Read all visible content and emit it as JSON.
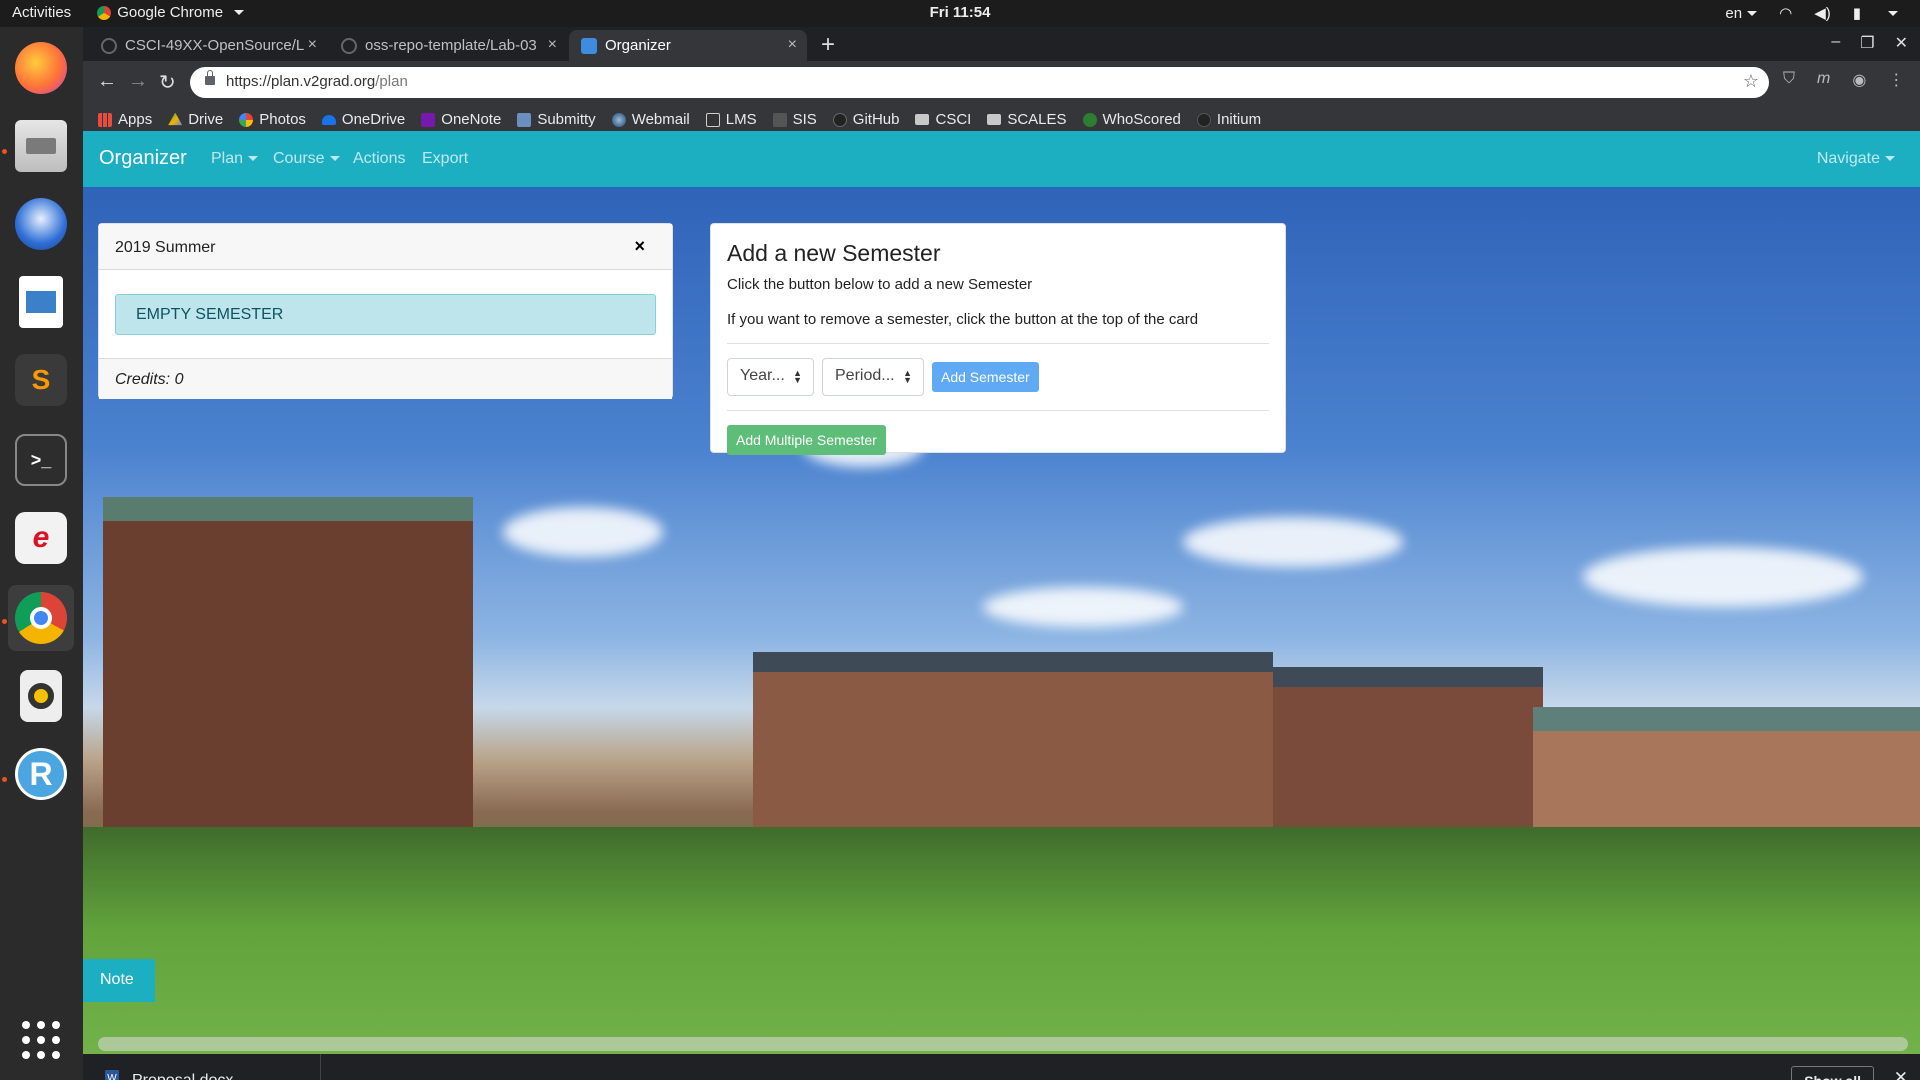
{
  "topbar": {
    "activities": "Activities",
    "app_name": "Google Chrome",
    "clock": "Fri 11:54",
    "lang": "en"
  },
  "dock": {
    "apps": [
      "firefox",
      "files",
      "thunderbird",
      "libreoffice-impress",
      "sublime-text",
      "terminal",
      "evince",
      "chrome",
      "rhythmbox",
      "rstudio"
    ]
  },
  "browser": {
    "tabs": [
      {
        "title": "CSCI-49XX-OpenSource/L"
      },
      {
        "title": "oss-repo-template/Lab-03"
      },
      {
        "title": "Organizer"
      }
    ],
    "url_host": "https://plan.v2grad.org",
    "url_path": "/plan",
    "bookmarks": [
      "Apps",
      "Drive",
      "Photos",
      "OneDrive",
      "OneNote",
      "Submitty",
      "Webmail",
      "LMS",
      "SIS",
      "GitHub",
      "CSCI",
      "SCALES",
      "WhoScored",
      "Initium"
    ]
  },
  "navbar": {
    "brand": "Organizer",
    "items": [
      "Plan",
      "Course",
      "Actions",
      "Export"
    ],
    "right": "Navigate"
  },
  "semester_card": {
    "title": "2019 Summer",
    "close": "×",
    "empty_label": "EMPTY SEMESTER",
    "credits": "Credits: 0"
  },
  "add_card": {
    "title": "Add a new Semester",
    "line1": "Click the button below to add a new Semester",
    "line2": "If you want to remove a semester, click the button at the top of the card",
    "year_select": "Year...",
    "period_select": "Period...",
    "add_button": "Add Semester",
    "add_multiple_button": "Add Multiple Semester"
  },
  "note_button": "Note",
  "downloads": {
    "file": "Proposal.docx",
    "show_all": "Show all"
  },
  "colors": {
    "navbar": "#1bafc1",
    "empty_alert": "#bee5eb",
    "primary": "#5fa9f5",
    "success": "#5fbd7a"
  }
}
